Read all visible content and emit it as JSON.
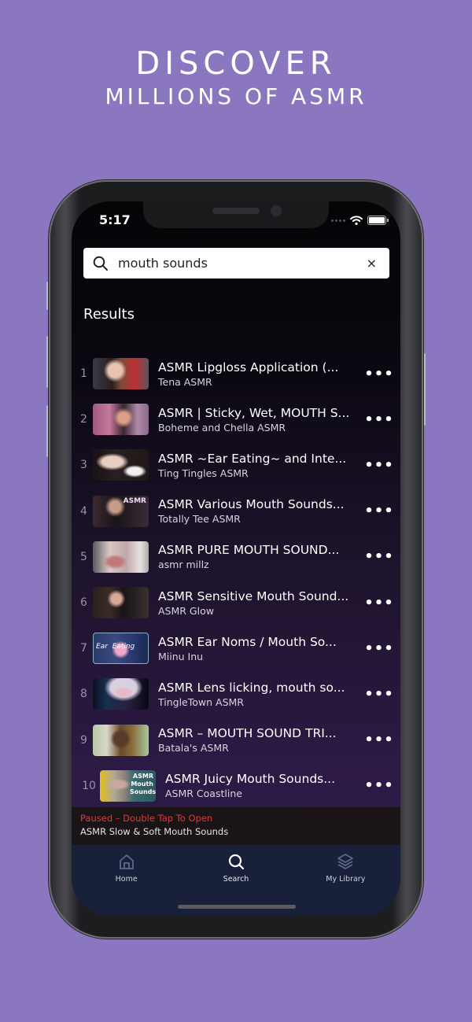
{
  "headline": {
    "line1": "DISCOVER",
    "line2": "MILLIONS OF ASMR"
  },
  "status_bar": {
    "time": "5:17"
  },
  "search": {
    "value": "mouth sounds",
    "clear_icon": "×"
  },
  "results": {
    "title": "Results",
    "more_label": "•••",
    "items": [
      {
        "rank": "1",
        "title": "ASMR Lipgloss Application (...",
        "channel": "Tena ASMR"
      },
      {
        "rank": "2",
        "title": "ASMR | Sticky, Wet, MOUTH S...",
        "channel": "Boheme and Chella ASMR"
      },
      {
        "rank": "3",
        "title": "ASMR ~Ear Eating~ and Inte...",
        "channel": "Ting Tingles ASMR"
      },
      {
        "rank": "4",
        "title": "ASMR Various Mouth Sounds...",
        "channel": "Totally Tee ASMR",
        "thumb_text": "ASMR"
      },
      {
        "rank": "5",
        "title": "ASMR PURE MOUTH SOUND...",
        "channel": "asmr millz"
      },
      {
        "rank": "6",
        "title": "ASMR Sensitive Mouth Sound...",
        "channel": "ASMR Glow"
      },
      {
        "rank": "7",
        "title": "ASMR Ear Noms / Mouth So...",
        "channel": "Miinu Inu",
        "thumb_text": "Ear  Eating"
      },
      {
        "rank": "8",
        "title": "ASMR Lens licking, mouth so...",
        "channel": "TingleTown ASMR"
      },
      {
        "rank": "9",
        "title": "ASMR – MOUTH SOUND TRI...",
        "channel": "Batala's ASMR"
      },
      {
        "rank": "10",
        "title": "ASMR Juicy Mouth Sounds...",
        "channel": "ASMR Coastline",
        "thumb_text": "ASMR Mouth Sounds"
      }
    ]
  },
  "now_playing": {
    "status": "Paused – Double Tap To Open",
    "title": "ASMR Slow & Soft Mouth Sounds",
    "status_color": "#d83a3a"
  },
  "tab_bar": {
    "tabs": [
      {
        "label": "Home",
        "icon": "home-icon",
        "active": false
      },
      {
        "label": "Search",
        "icon": "search-icon",
        "active": true
      },
      {
        "label": "My Library",
        "icon": "layers-icon",
        "active": false
      }
    ]
  },
  "colors": {
    "background": "#8b77bf",
    "tab_bar": "#18203a",
    "inactive_icon": "#5f6a8f",
    "active_icon": "#ffffff"
  }
}
